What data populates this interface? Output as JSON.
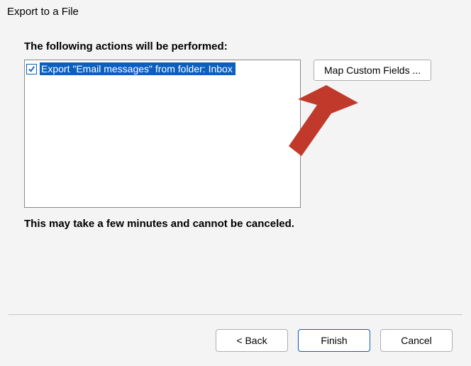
{
  "title": "Export to a File",
  "panel": {
    "label": "The following actions will be performed:",
    "items": [
      {
        "checked": true,
        "text": "Export \"Email messages\" from folder: Inbox"
      }
    ],
    "map_button": "Map Custom Fields ...",
    "note": "This may take a few minutes and cannot be canceled."
  },
  "footer": {
    "back": "<  Back",
    "finish": "Finish",
    "cancel": "Cancel"
  },
  "colors": {
    "accent": "#0a5fbf",
    "arrow": "#c0392b"
  }
}
